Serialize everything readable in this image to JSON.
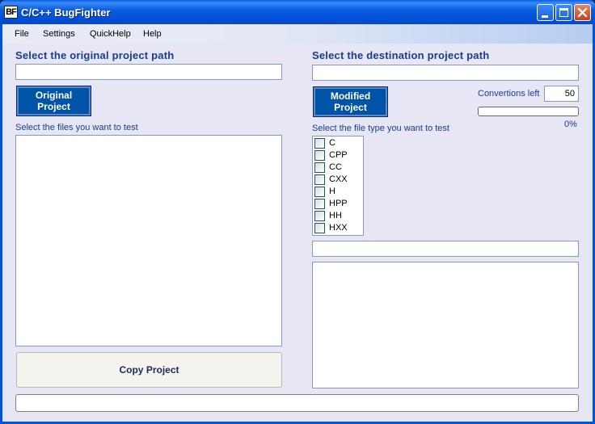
{
  "window": {
    "icon_text": "BF",
    "title": "C/C++ BugFighter"
  },
  "menu": {
    "items": [
      {
        "label": "File"
      },
      {
        "label": "Settings"
      },
      {
        "label": "QuickHelp"
      },
      {
        "label": "Help"
      }
    ]
  },
  "original": {
    "heading": "Select the original project path",
    "path_value": "",
    "button_label": "Original\nProject",
    "files_caption": "Select the files you want to test",
    "files": []
  },
  "destination": {
    "heading": "Select the destination project path",
    "path_value": "",
    "button_label": "Modified\nProject",
    "conversions_label": "Convertions left",
    "conversions_value": "50",
    "progress_percent": 0,
    "progress_text": "0%",
    "filetype_caption": "Select the file type you want to test",
    "filetypes": [
      {
        "label": "C",
        "checked": false
      },
      {
        "label": "CPP",
        "checked": false
      },
      {
        "label": "CC",
        "checked": false
      },
      {
        "label": "CXX",
        "checked": false
      },
      {
        "label": "H",
        "checked": false
      },
      {
        "label": "HPP",
        "checked": false
      },
      {
        "label": "HH",
        "checked": false
      },
      {
        "label": "HXX",
        "checked": false
      }
    ],
    "filter_value": "",
    "log_text": ""
  },
  "copy_button_label": "Copy Project",
  "status_text": ""
}
